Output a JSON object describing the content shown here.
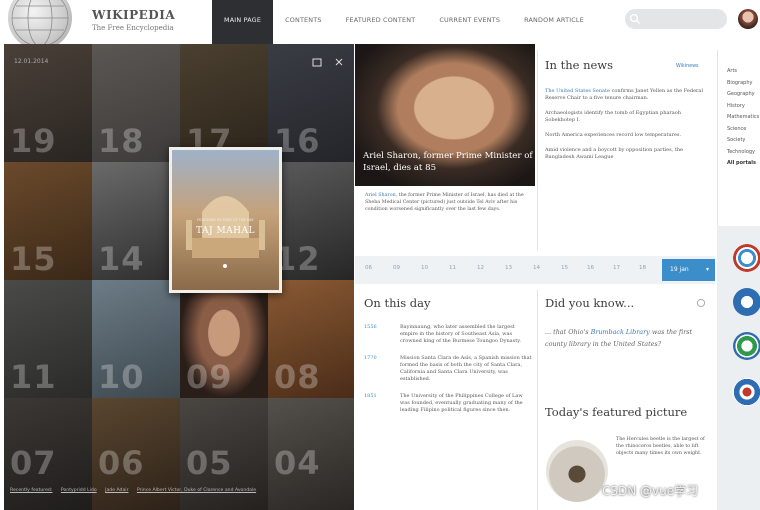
{
  "header": {
    "wordmark": "WIKIPEDIA",
    "tagline": "The Free Encyclopedia",
    "nav": [
      "MAIN PAGE",
      "CONTENTS",
      "FEATURED CONTENT",
      "CURRENT EVENTS",
      "RANDOM ARTICLE"
    ],
    "active_nav": "MAIN PAGE"
  },
  "mosaic": {
    "date": "12.01.2014",
    "tile_numbers": [
      "19",
      "18",
      "17",
      "16",
      "15",
      "14",
      "13",
      "12",
      "11",
      "10",
      "09",
      "08",
      "07",
      "06",
      "05",
      "04"
    ],
    "card": {
      "subtitle": "FEATURED PICTURE OF THE DAY",
      "title": "TAJ MAHAL"
    },
    "bottom_links": [
      "Recently featured:",
      "Pontypridd Lido",
      "Jade Adair",
      "Prince Albert Victor, Duke of Clarence and Avondale"
    ]
  },
  "featured_article": {
    "caption": "Ariel Sharon, former Prime Minister of Israel, dies at 85",
    "body_link": "Ariel Sharon,",
    "body": "the former Prime Minister of Israel, has died at the Sheba Medical Center (pictured) just outside Tel Aviv after his condition worsened significantly over the last few days."
  },
  "date_strip": {
    "dates": [
      "06",
      "09",
      "10",
      "11",
      "12",
      "13",
      "14",
      "15",
      "16",
      "17",
      "18"
    ],
    "selected": "19 jan"
  },
  "in_the_news": {
    "title": "In the news",
    "more_link": "Wikinews",
    "items": [
      {
        "link": "The United States Senate",
        "text": "confirms Janet Yellen as the Federal Reserve Chair to a five tenure chairman."
      },
      {
        "link": "",
        "text": "Archaeologists identify the tomb of Egyptian pharaoh Sobekhotep I."
      },
      {
        "link": "",
        "text": "North America experiences record low temperatures."
      },
      {
        "link": "",
        "text": "Amid violence and a boycott by opposition parties, the Bangladesh Awami League"
      }
    ]
  },
  "on_this_day": {
    "title": "On this day",
    "items": [
      {
        "year": "1556",
        "text": "Bayinnaung, who later assembled the largest empire in the history of Southeast Asia, was crowned king of the Burmese Toungoo Dynasty."
      },
      {
        "year": "1770",
        "text": "Mission Santa Clara de Asis, a Spanish mission that formed the basis of both the city of Santa Clara, California and Santa Clara University, was established."
      },
      {
        "year": "1851",
        "text": "The University of the Philippines College of Law was founded, eventually graduating many of the leading Filipino political figures since then."
      }
    ]
  },
  "did_you_know": {
    "title": "Did you know...",
    "text_pre": "... that Ohio's",
    "link": "Brumback Library",
    "text_post": "was the first county library in the United States?"
  },
  "featured_picture": {
    "title": "Today's featured picture",
    "text": "The Hercules beetle is the largest of the rhinoceros beetles, able to lift objects many times its own weight."
  },
  "portals": [
    "Arts",
    "Biography",
    "Geography",
    "History",
    "Mathematics",
    "Science",
    "Society",
    "Technology"
  ],
  "portals_all": "All portals",
  "watermark": "CSDN @vue学习",
  "colors": {
    "accent": "#3b8ec9",
    "link": "#3b7ab8",
    "nav_active": "#2e2f33"
  }
}
